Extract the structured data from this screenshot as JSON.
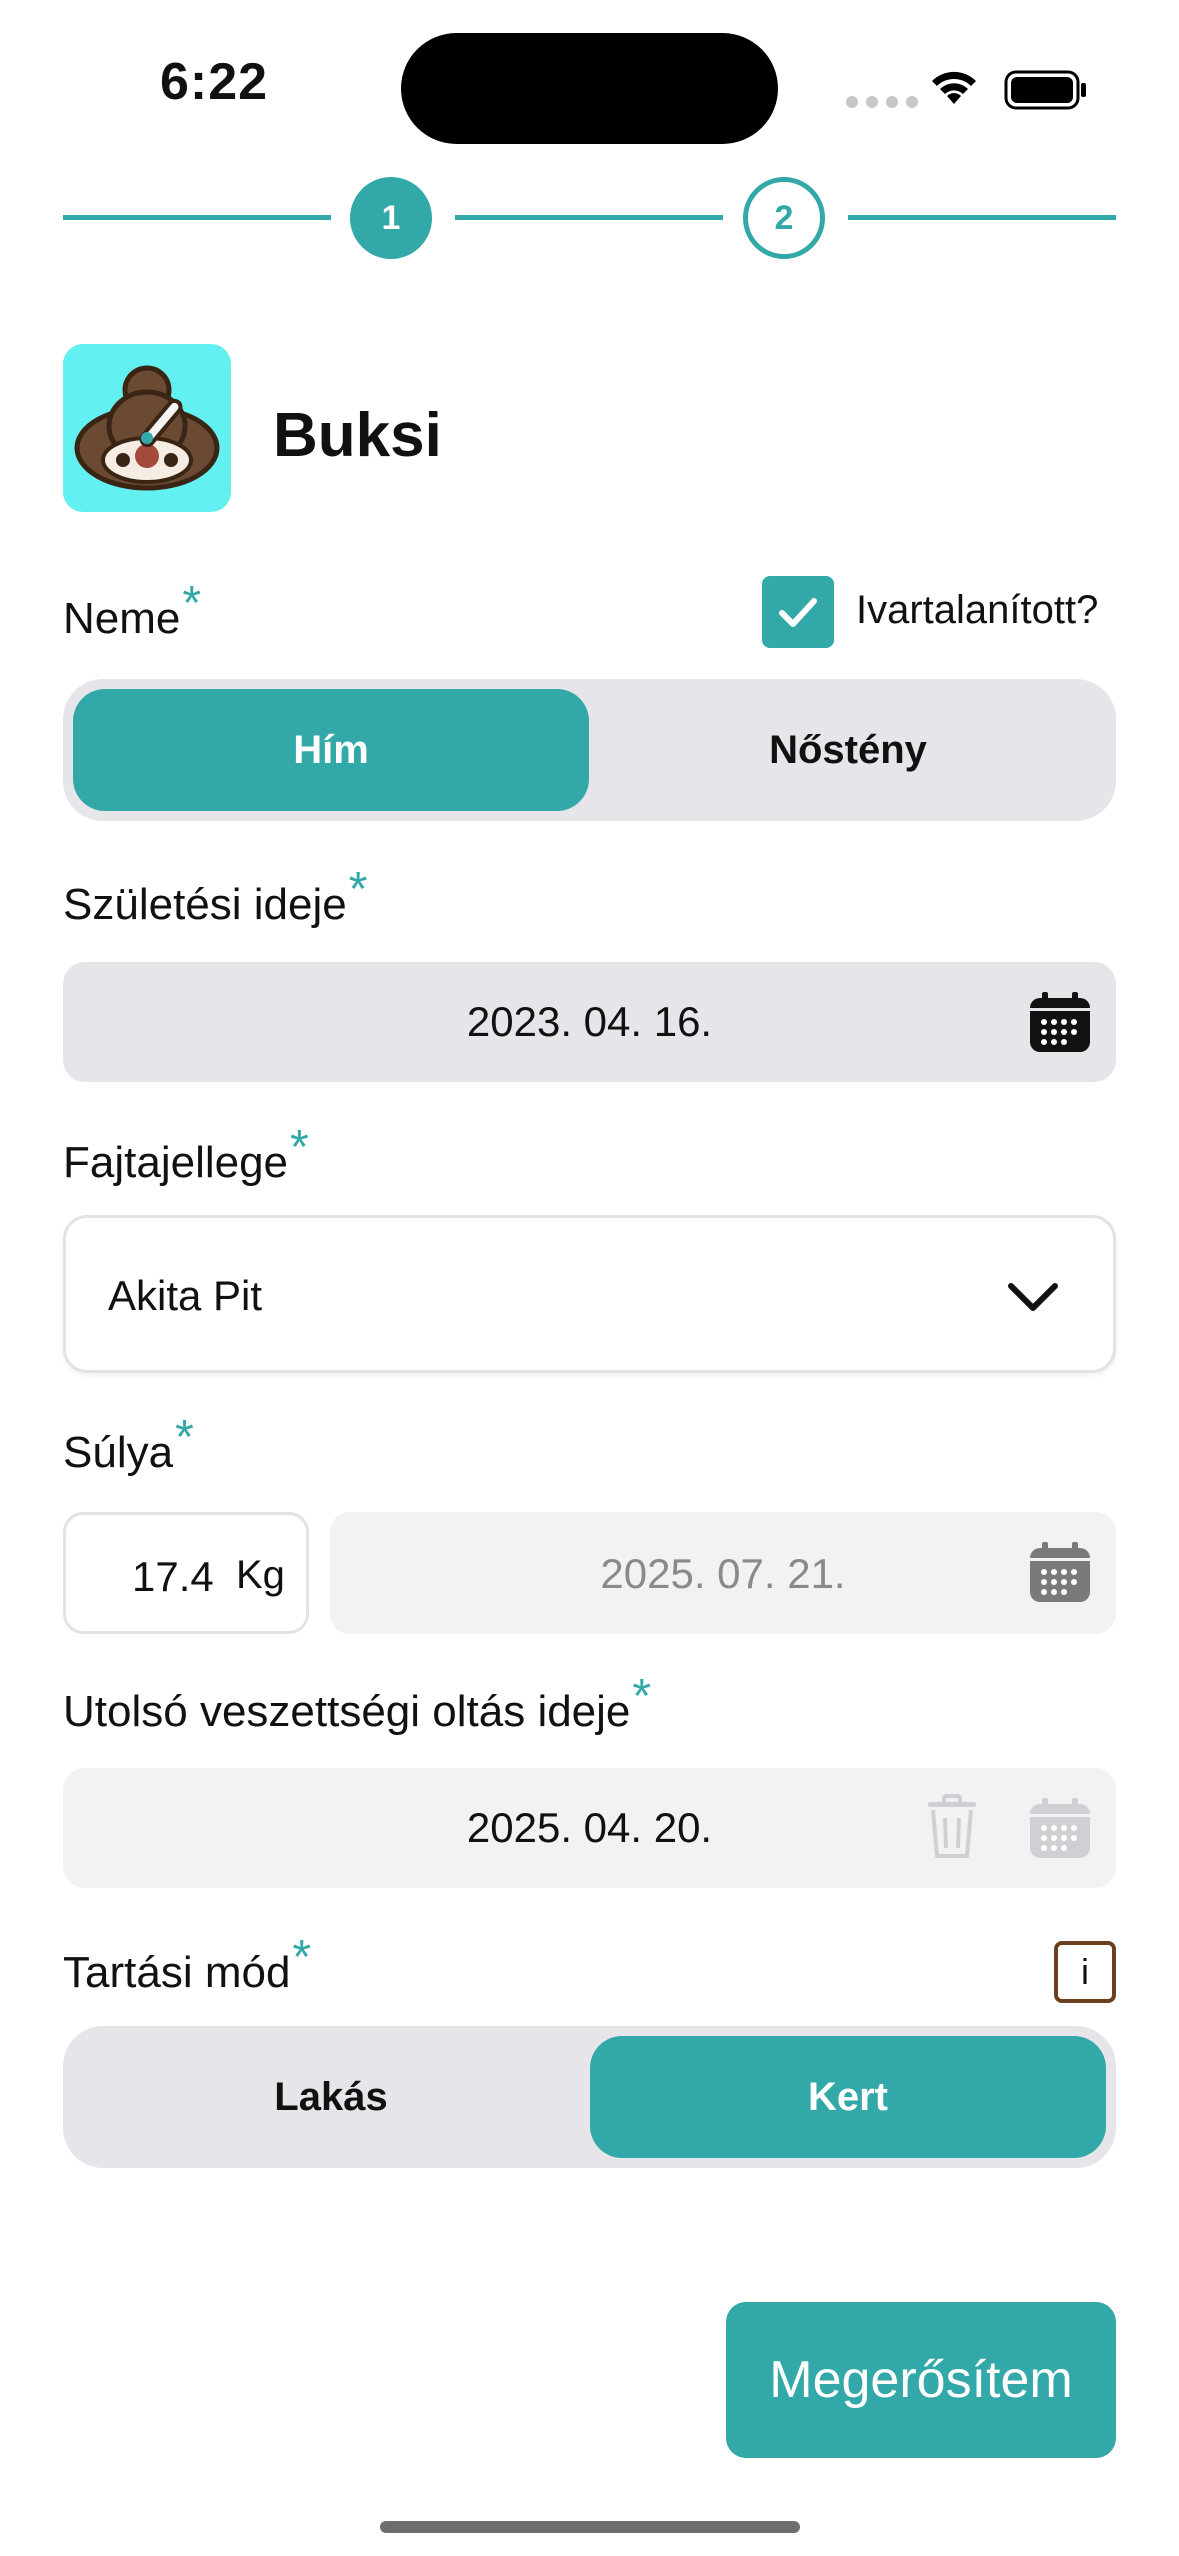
{
  "status_bar": {
    "time": "6:22"
  },
  "stepper": {
    "steps": [
      "1",
      "2"
    ],
    "current": 1
  },
  "pet": {
    "name": "Buksi"
  },
  "sex": {
    "label": "Neme",
    "required_mark": "*",
    "neutered_label": "Ivartalanított?",
    "neutered_checked": true,
    "options": [
      "Hím",
      "Nőstény"
    ],
    "selected": "Hím"
  },
  "birth_date": {
    "label": "Születési ideje",
    "required_mark": "*",
    "value": "2023. 04. 16."
  },
  "breed": {
    "label": "Fajtajellege",
    "required_mark": "*",
    "value": "Akita Pit"
  },
  "weight": {
    "label": "Súlya",
    "required_mark": "*",
    "value": "17.4",
    "unit": "Kg",
    "date": "2025. 07. 21."
  },
  "rabies": {
    "label": "Utolsó veszettségi oltás ideje",
    "required_mark": "*",
    "value": "2025. 04. 20."
  },
  "housing": {
    "label": "Tartási mód",
    "required_mark": "*",
    "info_label": "i",
    "options": [
      "Lakás",
      "Kert"
    ],
    "selected": "Kert"
  },
  "confirm_label": "Megerősítem",
  "colors": {
    "accent": "#33a8a8",
    "field_bg": "#e6e6ea",
    "avatar_bg": "#62f0f0",
    "info_border": "#6b4021"
  }
}
